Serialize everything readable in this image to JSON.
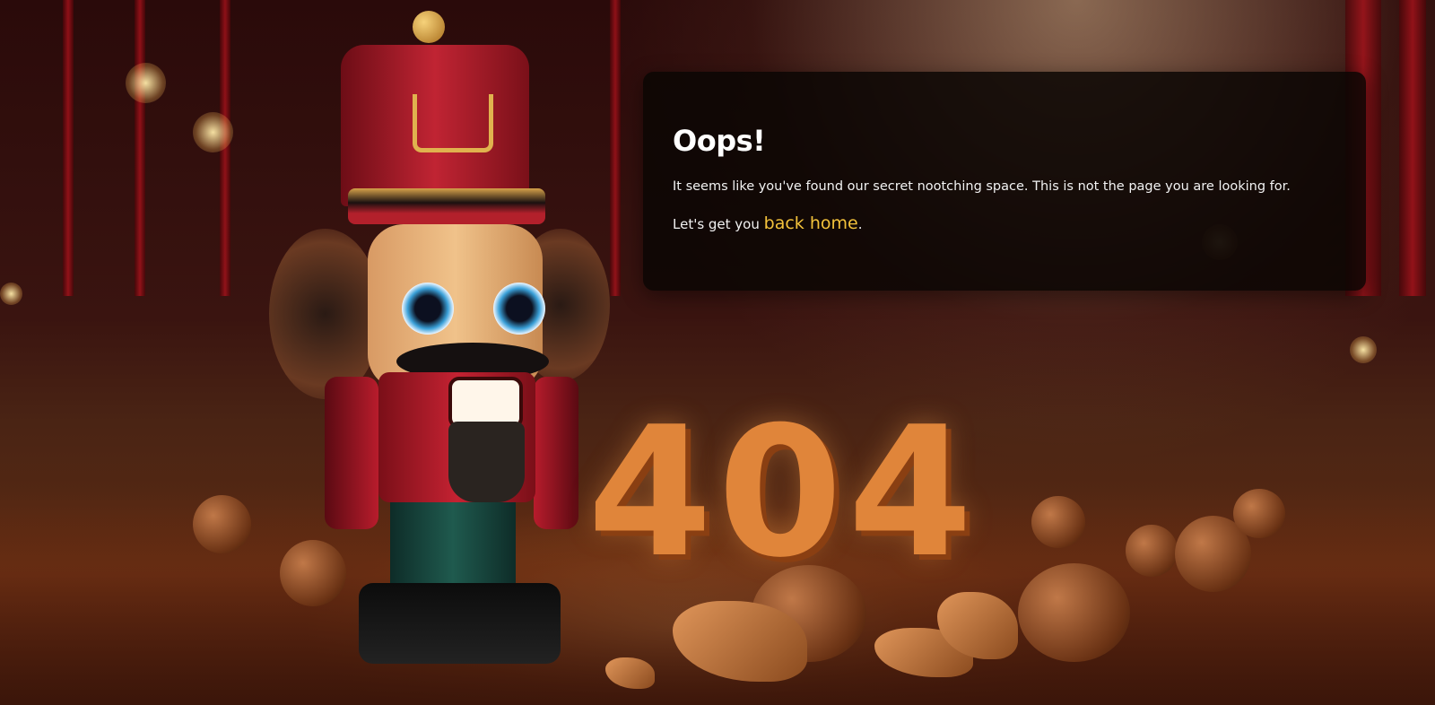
{
  "error": {
    "title": "Oops!",
    "message": "It seems like you've found our secret nootching space. This is not the page you are looking for.",
    "prompt_prefix": "Let's get you ",
    "home_link_label": "back home",
    "prompt_suffix": "."
  },
  "illustration": {
    "code": "404"
  },
  "colors": {
    "link": "#f3c23b",
    "card_background": "rgba(10,6,4,0.86)",
    "title": "#ffffff"
  }
}
